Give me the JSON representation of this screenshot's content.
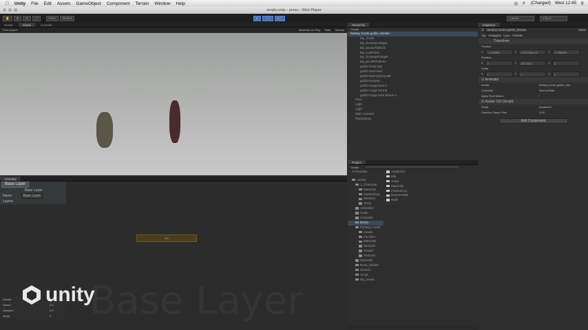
{
  "menubar": {
    "items": [
      "Unity",
      "File",
      "Edit",
      "Assets",
      "GameObject",
      "Component",
      "Terrain",
      "Window",
      "Help"
    ],
    "battery": "(Charged)",
    "clock": "Wed 12:45"
  },
  "window": {
    "title": "empty.unity - preso - Web Player"
  },
  "toolbar": {
    "pivot": "Pivot",
    "global": "Global",
    "layers": "Layers",
    "layout": "2 by 3"
  },
  "tabs": {
    "scene": "Scene",
    "game": "Game",
    "console": "Console",
    "aspect": "Free Aspect",
    "maximize": "Maximize on Play",
    "stats": "Stats",
    "gizmos": "Gizmos"
  },
  "animator": {
    "tab": "Animator",
    "layer_tab": "Base Layer",
    "layer_value": "Base Layer",
    "name_label": "Name",
    "name_value": "Base Layer",
    "layers_label": "Layers",
    "events_label": "Events",
    "params": [
      {
        "name": "Speed",
        "value": "0.0"
      },
      {
        "name": "Direction",
        "value": "0.0"
      },
      {
        "name": "Jump",
        "value": "0"
      }
    ],
    "watermark": "Base Layer",
    "state": "Idle"
  },
  "logo": {
    "text": "unity"
  },
  "hierarchy": {
    "tab": "Hierarchy",
    "create": "Create",
    "items": [
      {
        "label": "fantasy horde-goblin_female",
        "indent": 0,
        "sel": true
      },
      {
        "label": "bip_mover",
        "indent": 2
      },
      {
        "label": "bip_footstepLTarget",
        "indent": 2
      },
      {
        "label": "bip_pivotLPlatform",
        "indent": 2
      },
      {
        "label": "bip_rootPelvis",
        "indent": 2
      },
      {
        "label": "bip_footstepRTarget",
        "indent": 2
      },
      {
        "label": "bip_pivotRPlatform",
        "indent": 2
      },
      {
        "label": "goblin-body-cap",
        "indent": 2
      },
      {
        "label": "goblin-boot-ears",
        "indent": 2
      },
      {
        "label": "goblin-bare-jammy-tail",
        "indent": 2
      },
      {
        "label": "goblin-hooded",
        "indent": 2
      },
      {
        "label": "goblin-rouge boot A",
        "indent": 2
      },
      {
        "label": "goblin-rouge boot B",
        "indent": 2
      },
      {
        "label": "goblin-rouge wrist bracer A",
        "indent": 2
      },
      {
        "label": "Floor",
        "indent": 1
      },
      {
        "label": "Light",
        "indent": 1
      },
      {
        "label": "Light",
        "indent": 1
      },
      {
        "label": "Main Camera",
        "indent": 1
      },
      {
        "label": "PaintedGuy",
        "indent": 1
      }
    ]
  },
  "project": {
    "tab": "Project",
    "create": "Create",
    "favorites": "Favorites",
    "tree": [
      {
        "label": "Assets",
        "indent": 0
      },
      {
        "label": "1_Character",
        "indent": 1
      },
      {
        "label": "Materials",
        "indent": 2
      },
      {
        "label": "PaintedGuy",
        "indent": 2
      },
      {
        "label": "Skeleton",
        "indent": 2
      },
      {
        "label": "Temp",
        "indent": 2
      },
      {
        "label": "Animation",
        "indent": 1
      },
      {
        "label": "Audio",
        "indent": 1
      },
      {
        "label": "Controller",
        "indent": 1
      },
      {
        "label": "Demo",
        "indent": 1,
        "sel": true
      },
      {
        "label": "Fantasy Horde",
        "indent": 1
      },
      {
        "label": "Assets",
        "indent": 2
      },
      {
        "label": "Fbx files",
        "indent": 2
      },
      {
        "label": "Materials",
        "indent": 2
      },
      {
        "label": "Samples",
        "indent": 2
      },
      {
        "label": "Shader",
        "indent": 2
      },
      {
        "label": "Textures",
        "indent": 2
      },
      {
        "label": "Materials",
        "indent": 1
      },
      {
        "label": "Rock_Cluster",
        "indent": 1
      },
      {
        "label": "Scenes",
        "indent": 1
      },
      {
        "label": "Script",
        "indent": 1
      },
      {
        "label": "wip_levels",
        "indent": 1
      }
    ],
    "files": [
      "AvatarCtrl",
      "Idle",
      "Jump",
      "Materials",
      "PaintedGuy",
      "RunnerState",
      "Walk"
    ]
  },
  "inspector": {
    "tab": "Inspector",
    "object_name": "fantasy horde-goblin_female",
    "static": "Static",
    "tag_label": "Tag",
    "tag": "Untagged",
    "layer_label": "Layer",
    "layer": "Default",
    "transform": {
      "title": "Transform",
      "position_label": "Position",
      "position": [
        "-1.233380",
        "2.871034e-07",
        "-2.933439"
      ],
      "rotation_label": "Rotation",
      "rotation": [
        "0",
        "237.5327",
        "0"
      ],
      "scale_label": "Scale",
      "scale": [
        "1",
        "1",
        "1"
      ]
    },
    "animator": {
      "title": "Animator",
      "avatar_label": "Avatar",
      "avatar": "fantasy horde-goblin_fem",
      "controller_label": "Controller",
      "controller": "RunnerState",
      "root_motion_label": "Apply Root Motion"
    },
    "script": {
      "title": "Avatar Ctrl (Script)",
      "script_label": "Script",
      "script": "AvatarCtrl",
      "damp_label": "Direction Damp Time",
      "damp": "0.25"
    },
    "add_component": "Add Component"
  }
}
